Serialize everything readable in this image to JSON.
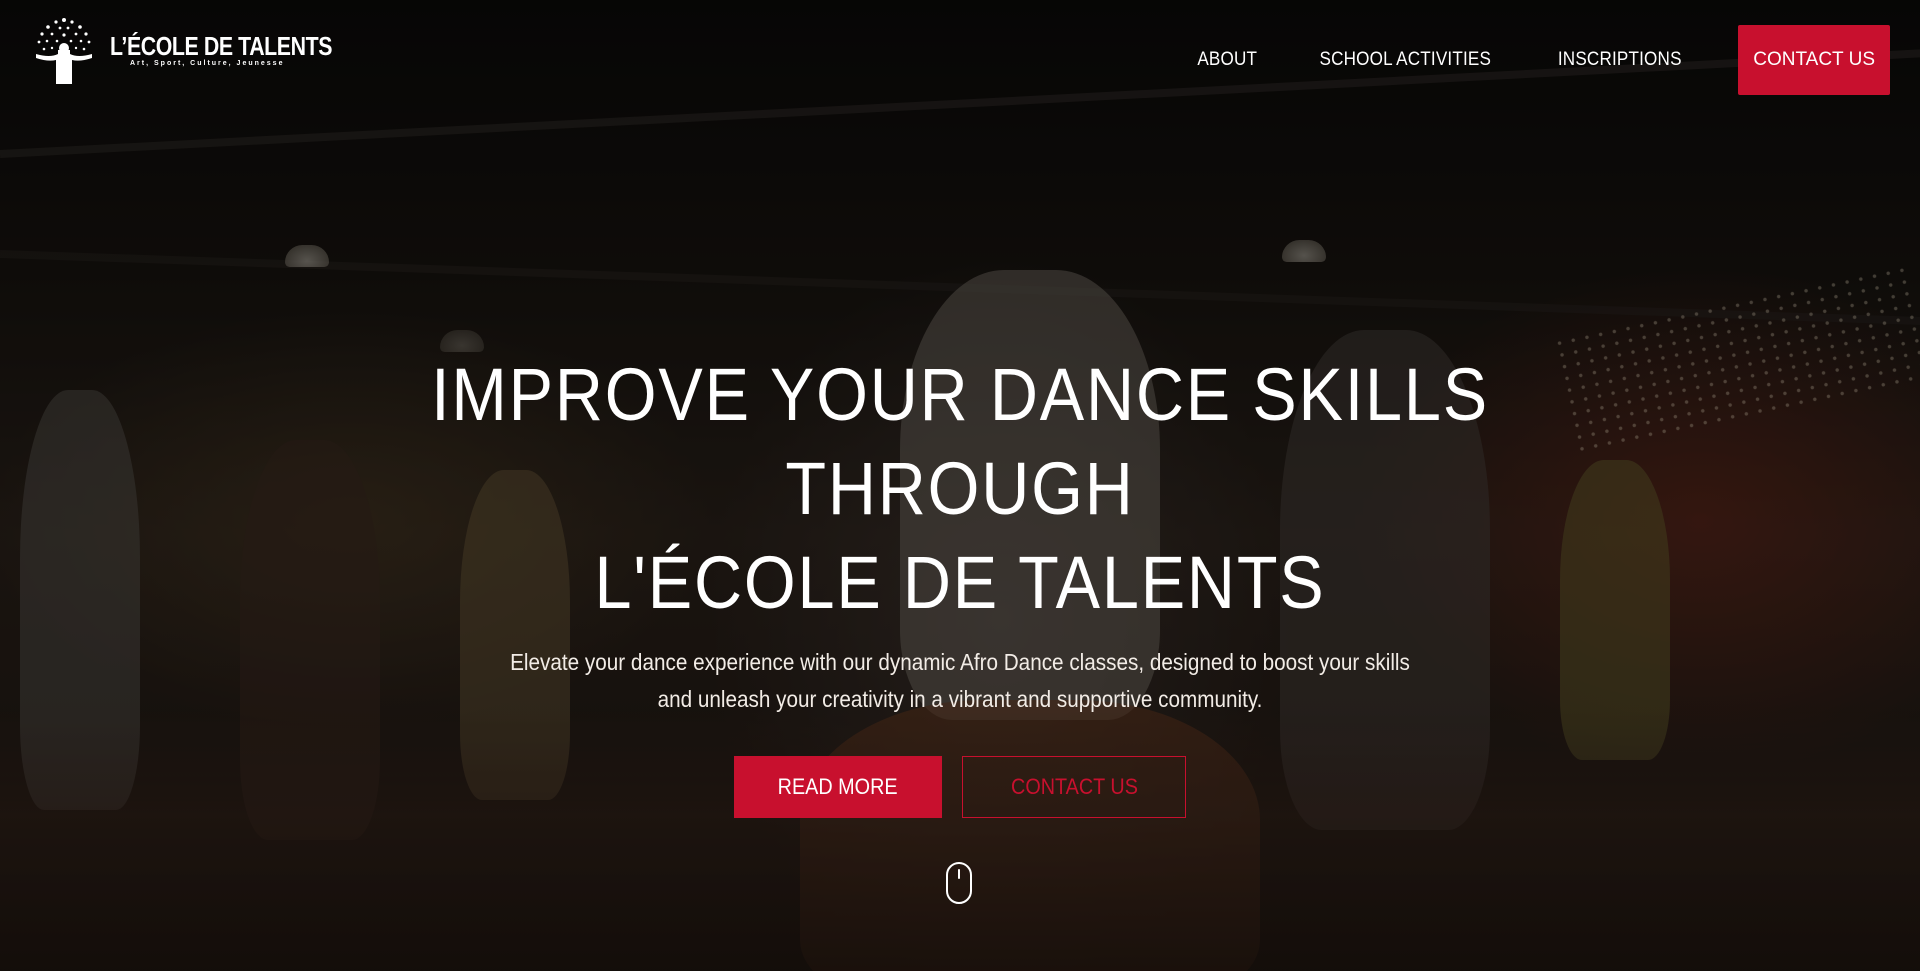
{
  "brand": {
    "name": "L’ÉCOLE DE TALENTS",
    "tagline": "Art, Sport, Culture, Jeunesse",
    "logo_icon": "tree-person-icon"
  },
  "nav": {
    "items": [
      {
        "label": "ABOUT"
      },
      {
        "label": "SCHOOL ACTIVITIES"
      },
      {
        "label": "INSCRIPTIONS"
      }
    ],
    "cta_label": "CONTACT US"
  },
  "hero": {
    "headline_line1": "IMPROVE YOUR DANCE SKILLS THROUGH",
    "headline_line2": "L'ÉCOLE DE TALENTS",
    "subtext": "Elevate your dance experience with our dynamic Afro Dance classes, designed to boost your skills and unleash your creativity in a vibrant and supportive community.",
    "primary_button": "READ MORE",
    "secondary_button": "CONTACT US",
    "scroll_icon": "mouse-scroll-icon"
  },
  "colors": {
    "accent": "#c8102e",
    "text": "#ffffff"
  }
}
